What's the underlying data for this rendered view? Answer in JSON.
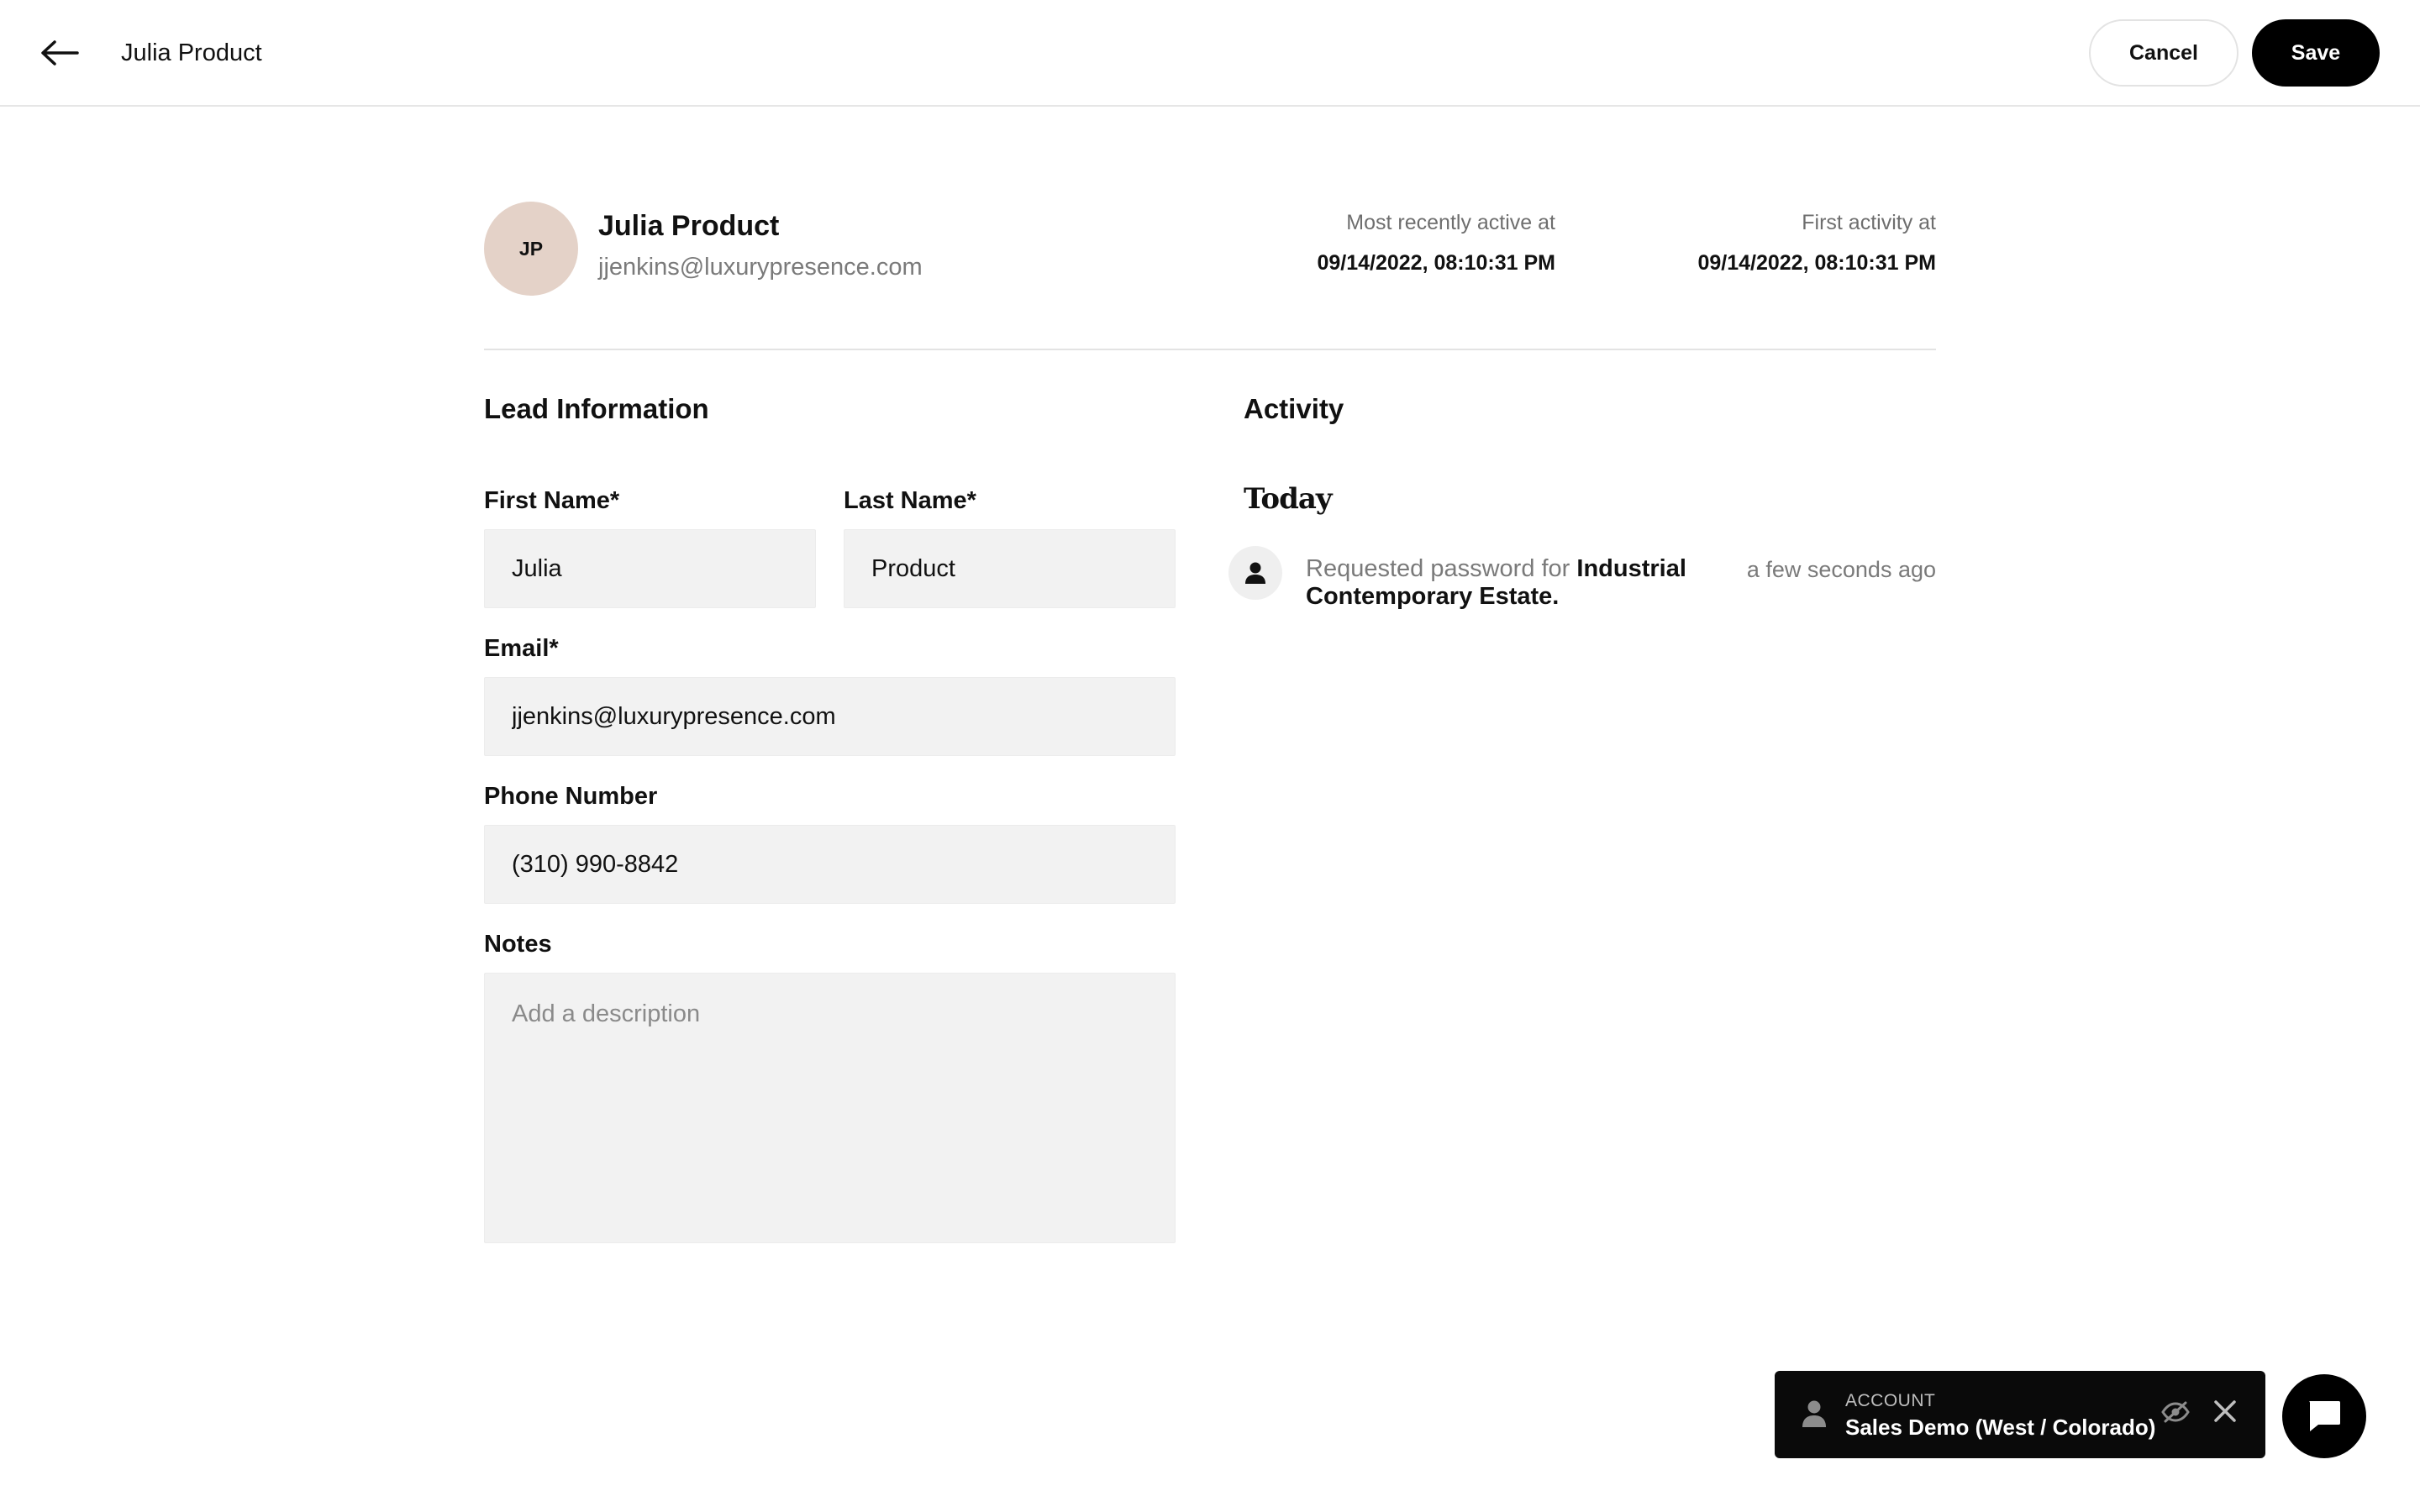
{
  "header": {
    "title": "Julia Product",
    "back_icon": "arrow-left-icon",
    "cancel_label": "Cancel",
    "save_label": "Save"
  },
  "profile": {
    "initials": "JP",
    "name": "Julia Product",
    "email": "jjenkins@luxurypresence.com",
    "avatar_color": "#e4d2c8",
    "most_recent_label": "Most recently active at",
    "most_recent_value": "09/14/2022, 08:10:31 PM",
    "first_activity_label": "First activity at",
    "first_activity_value": "09/14/2022, 08:10:31 PM"
  },
  "lead": {
    "section_title": "Lead Information",
    "first_name_label": "First Name*",
    "first_name_value": "Julia",
    "last_name_label": "Last Name*",
    "last_name_value": "Product",
    "email_label": "Email*",
    "email_value": "jjenkins@luxurypresence.com",
    "phone_label": "Phone Number",
    "phone_value": "(310) 990-8842",
    "notes_label": "Notes",
    "notes_placeholder": "Add a description"
  },
  "activity": {
    "section_title": "Activity",
    "day_heading": "Today",
    "items": [
      {
        "icon": "person-icon",
        "text_prefix": "Requested password for ",
        "text_bold": "Industrial Contemporary Estate.",
        "time": "a few seconds ago"
      }
    ]
  },
  "account_toast": {
    "label": "ACCOUNT",
    "value": "Sales Demo (West / Colorado)",
    "icons": [
      "person-icon",
      "eye-off-icon",
      "close-icon"
    ]
  },
  "chat": {
    "icon": "chat-bubble-icon"
  },
  "colors": {
    "primary_button": "#000000",
    "input_background": "#f2f2f2",
    "muted_text": "#7a7a7a"
  }
}
